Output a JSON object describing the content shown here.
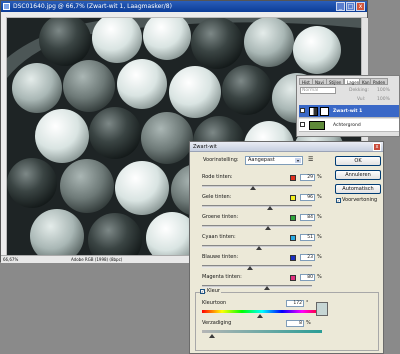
{
  "image_window": {
    "title": "DSC01640.jpg @ 66,7% (Zwart-wit 1, Laagmasker/8)",
    "status_zoom": "66,67%",
    "status_profile": "Adobe RGB (1998) (8bpc)",
    "buttons": [
      "_",
      "□",
      "x"
    ]
  },
  "layers_panel": {
    "tabs": [
      "Hist",
      "Navi",
      "Stijlen",
      "Lagen",
      "Kan",
      "Paden"
    ],
    "active_tab": "Lagen",
    "blend_mode": "Normal",
    "opacity_label": "Dekking:",
    "opacity_value": "100%",
    "fill_label": "Vul:",
    "fill_value": "100%",
    "layers": [
      {
        "name": "Zwart-wit 1",
        "bold": true
      },
      {
        "name": "Achtergrond",
        "bold": false
      }
    ]
  },
  "dialog": {
    "title": "Zwart-wit",
    "preset_label": "Voorinstelling:",
    "preset_value": "Aangepast",
    "sliders": [
      {
        "label": "Rode tinten:",
        "value": "29",
        "color": "#e0301e",
        "fraction": 0.46
      },
      {
        "label": "Gele tinten:",
        "value": "96",
        "color": "#f2ee1c",
        "fraction": 0.62
      },
      {
        "label": "Groene tinten:",
        "value": "84",
        "color": "#2fa53a",
        "fraction": 0.6
      },
      {
        "label": "Cyaan tinten:",
        "value": "51",
        "color": "#27a9e1",
        "fraction": 0.52
      },
      {
        "label": "Blauwe tinten:",
        "value": "23",
        "color": "#1b2fc0",
        "fraction": 0.44
      },
      {
        "label": "Magenta tinten:",
        "value": "80",
        "color": "#e0307e",
        "fraction": 0.59
      }
    ],
    "percent": "%",
    "buttons": {
      "ok": "OK",
      "cancel": "Annuleren",
      "auto": "Automatisch"
    },
    "preview_label": "Voorvertoning",
    "kleur_label": "Kleur",
    "hue_label": "Kleurtoon",
    "hue_value": "172",
    "hue_unit": "°",
    "hue_fraction": 0.48,
    "sat_label": "Verzadiging",
    "sat_value": "8",
    "sat_unit": "%",
    "sat_fraction": 0.08,
    "tint_color": "#c6d6d4",
    "accent": "#0b3c97"
  }
}
